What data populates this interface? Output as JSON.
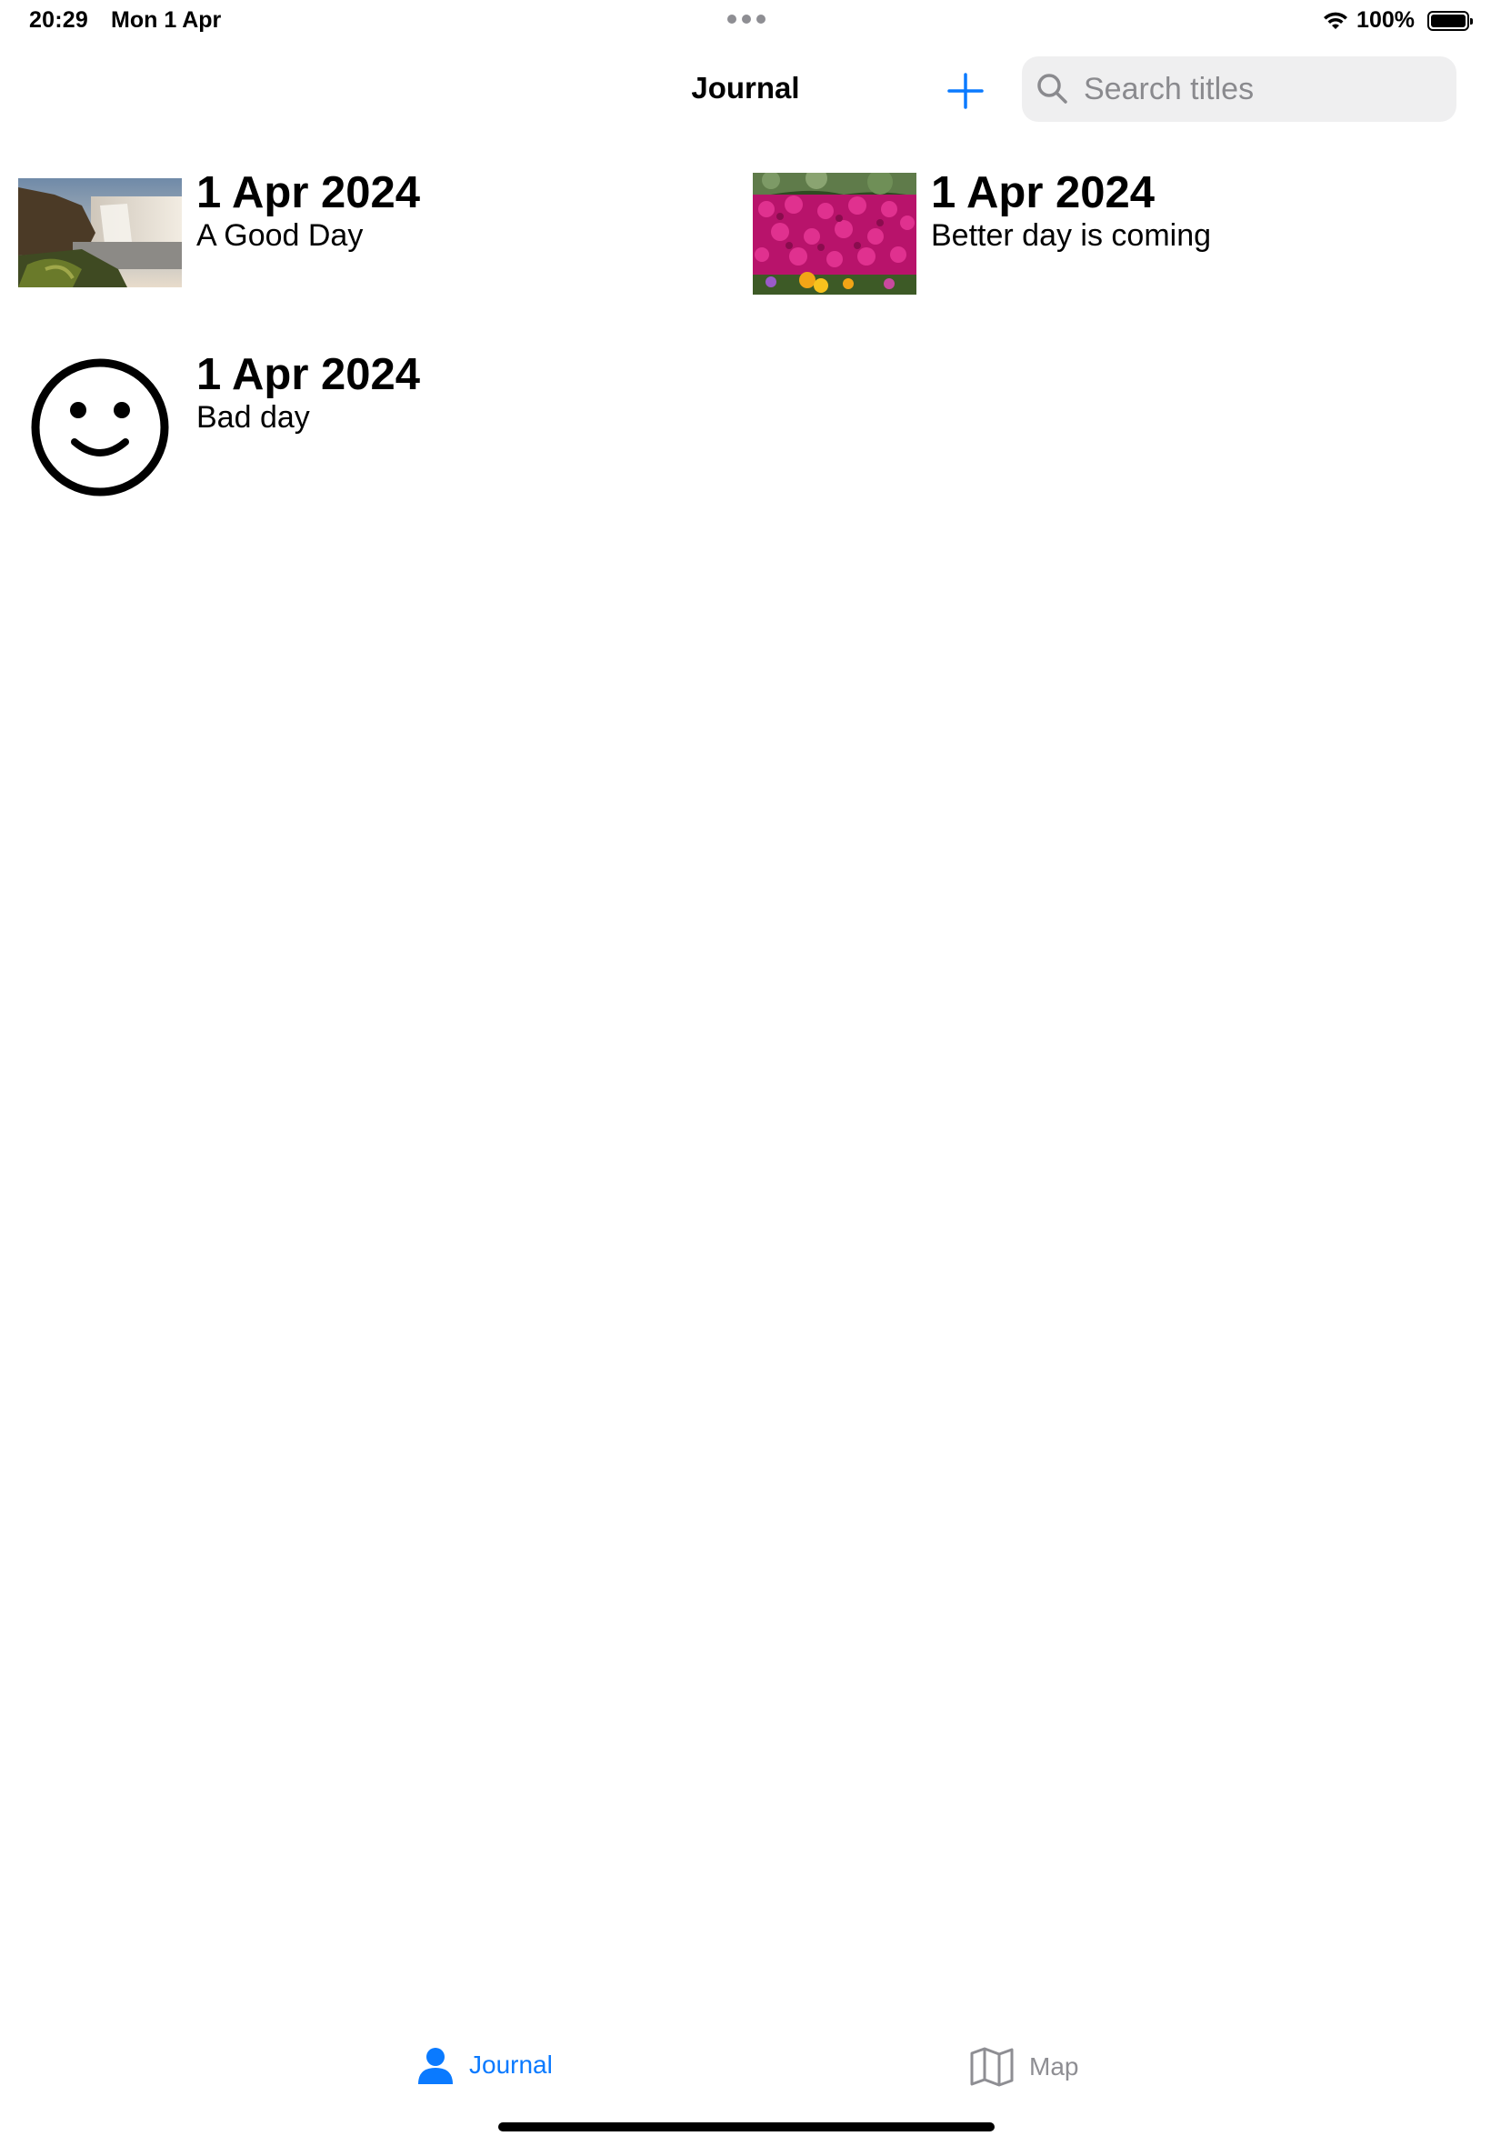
{
  "status_bar": {
    "time": "20:29",
    "date": "Mon 1 Apr",
    "battery": "100%"
  },
  "nav": {
    "title": "Journal",
    "search_placeholder": "Search titles"
  },
  "entries": [
    {
      "date": "1 Apr 2024",
      "title": "A Good Day",
      "image": "waterfall-photo"
    },
    {
      "date": "1 Apr 2024",
      "title": "Better day is coming",
      "image": "pink-flowers-photo"
    },
    {
      "date": "1 Apr 2024",
      "title": "Bad day",
      "image": "smiley-face-icon"
    }
  ],
  "tabs": [
    {
      "label": "Journal",
      "icon": "person-icon",
      "selected": true
    },
    {
      "label": "Map",
      "icon": "map-icon",
      "selected": false
    }
  ],
  "colors": {
    "accent": "#0a7aff",
    "inactive_tab": "#8e8e93",
    "search_bg": "#efeff0"
  }
}
